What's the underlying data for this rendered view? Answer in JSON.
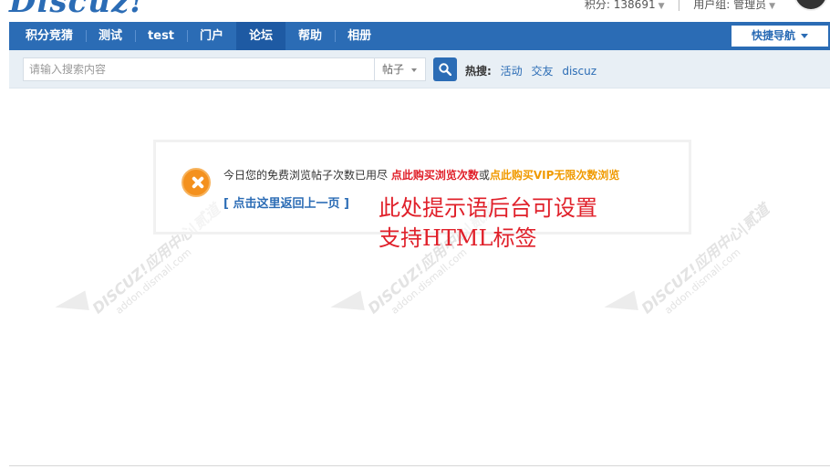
{
  "header": {
    "logo": "Discuz",
    "logo_suffix": "!",
    "points": "积分: 138691",
    "usergroup": "用户组: 管理员"
  },
  "nav": {
    "items": [
      {
        "label": "积分竞猜",
        "active": false
      },
      {
        "label": "测试",
        "active": false
      },
      {
        "label": "test",
        "active": false
      },
      {
        "label": "门户",
        "active": false
      },
      {
        "label": "论坛",
        "active": true
      },
      {
        "label": "帮助",
        "active": false
      },
      {
        "label": "相册",
        "active": false
      }
    ],
    "quick_nav": "快捷导航"
  },
  "search": {
    "placeholder": "请输入搜索内容",
    "type": "帖子",
    "hot_label": "热搜:",
    "hot_keywords": [
      "活动",
      "交友",
      "discuz"
    ]
  },
  "message": {
    "text": "今日您的免费浏览帖子次数已用尽",
    "buy_link": "点此购买浏览次数",
    "or": "或",
    "vip_link": "点此购买VIP无限次数浏览",
    "back_link": "[ 点击这里返回上一页 ]"
  },
  "annotation": {
    "line1": "此处提示语后台可设置",
    "line2": "支持HTML标签"
  },
  "watermark": {
    "main": "DISCUZ!应用中心|贰道",
    "sub": "addon.dismall.com"
  },
  "colors": {
    "nav_bg": "#2b6cb5",
    "buy_link": "#e0202a",
    "vip_link": "#f09a00",
    "annotation": "#e0202a"
  }
}
